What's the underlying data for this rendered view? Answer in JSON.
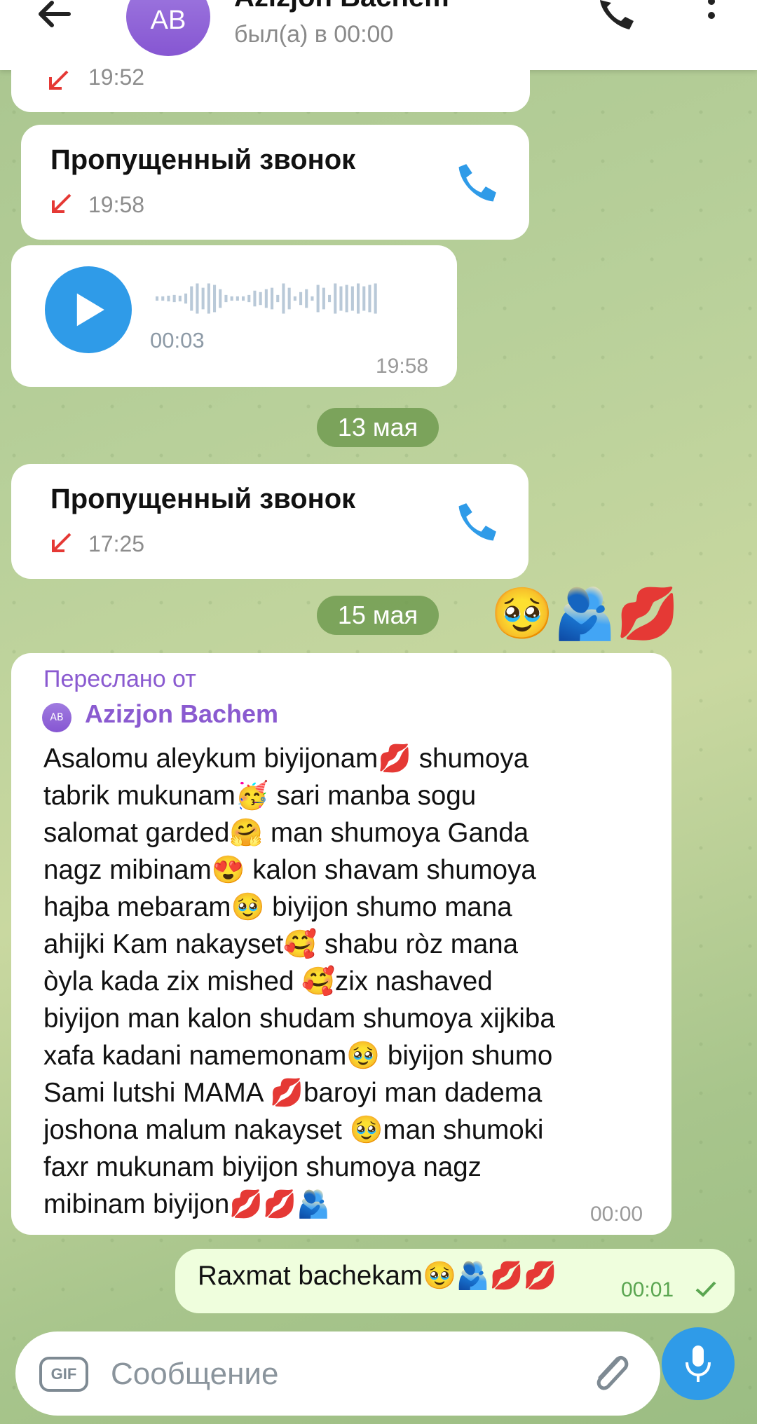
{
  "header": {
    "contact_name": "Azizjon Bachem",
    "avatar_initials": "AB",
    "status": "был(а) в 00:00"
  },
  "messages": {
    "top_partial_time": "19:52",
    "missed_call_1": {
      "label": "Пропущенный звонок",
      "time": "19:58"
    },
    "voice": {
      "duration": "00:03",
      "time": "19:58"
    },
    "date_1": "13 мая",
    "missed_call_2": {
      "label": "Пропущенный звонок",
      "time": "17:25"
    },
    "date_2": "15 мая",
    "reaction_emojis": "🥹🫂💋",
    "forwarded": {
      "label": "Переслано от",
      "from_initials": "AB",
      "from_name": "Azizjon Bachem",
      "text": "Asalomu aleykum biyijonam💋 shumoya\ntabrik mukunam🥳 sari manba sogu\nsalomat garded🤗 man shumoya Ganda\nnagz mibinam😍 kalon shavam shumoya\nhajba mebaram🥹 biyijon shumo mana\nahijki Kam nakayset🥰 shabu ròz mana\nòyla kada zix mished 🥰zix nashaved\nbiyijon man kalon shudam shumoya xijkiba\nxafa kadani namemonam🥹 biyijon shumo\nSami lutshi MAMA 💋baroyi man dadema\njoshona malum nakayset 🥹man shumoki\nfaxr mukunam biyijon shumoya nagz\nmibinam biyijon💋💋🫂",
      "time": "00:00"
    },
    "outgoing": {
      "text": "Raxmat bachekam🥹🫂💋💋",
      "time": "00:01"
    }
  },
  "composer": {
    "gif_label": "GIF",
    "placeholder": "Сообщение"
  },
  "colors": {
    "accent": "#2f9be8",
    "missed": "#e53935",
    "forward": "#8a5ad0",
    "outgoing_bubble": "#effedd",
    "date_pill": "#709b50"
  }
}
